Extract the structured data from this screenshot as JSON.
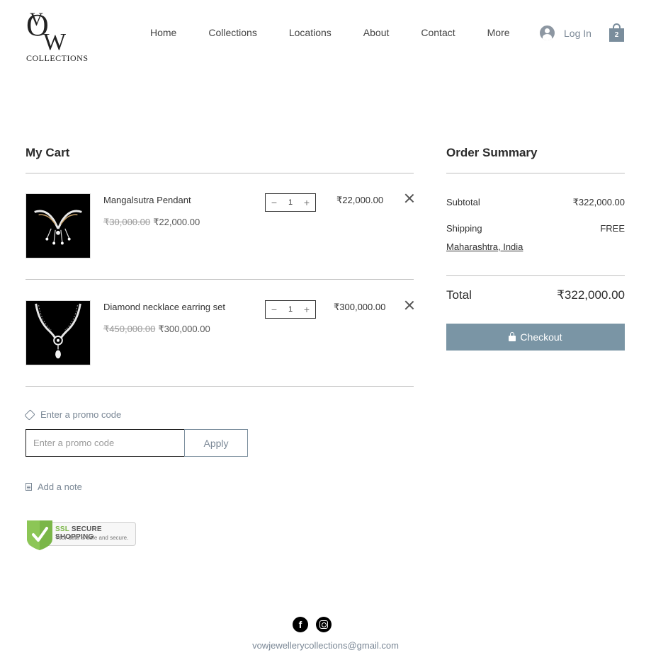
{
  "brand": {
    "logo_text": "COLLECTIONS"
  },
  "nav": [
    "Home",
    "Collections",
    "Locations",
    "About",
    "Contact",
    "More"
  ],
  "header": {
    "login_label": "Log In",
    "cart_count": "2"
  },
  "cart": {
    "title": "My Cart",
    "items": [
      {
        "name": "Mangalsutra Pendant",
        "original_price": "₹30,000.00",
        "sale_price": "₹22,000.00",
        "quantity": "1",
        "line_total": "₹22,000.00"
      },
      {
        "name": "Diamond necklace earring set",
        "original_price": "₹450,000.00",
        "sale_price": "₹300,000.00",
        "quantity": "1",
        "line_total": "₹300,000.00"
      }
    ],
    "qty_minus": "−",
    "qty_plus": "+"
  },
  "promo": {
    "link_label": "Enter a promo code",
    "placeholder": "Enter a promo code",
    "apply_label": "Apply"
  },
  "note": {
    "label": "Add a note"
  },
  "ssl_badge": {
    "title_ssl": "SSL",
    "title_rest": "SECURE SHOPPING",
    "subtitle": "Your data is safe and secure."
  },
  "summary": {
    "title": "Order Summary",
    "subtotal_label": "Subtotal",
    "subtotal_value": "₹322,000.00",
    "shipping_label": "Shipping",
    "shipping_value": "FREE",
    "shipping_location": "Maharashtra, India",
    "total_label": "Total",
    "total_value": "₹322,000.00",
    "checkout_label": "Checkout"
  },
  "footer": {
    "email": "vowjewellerycollections@gmail.com",
    "facebook_glyph": "f"
  },
  "colors": {
    "accent": "#7a95a5",
    "muted_text": "#7b8896",
    "divider": "#bfbfbf"
  }
}
